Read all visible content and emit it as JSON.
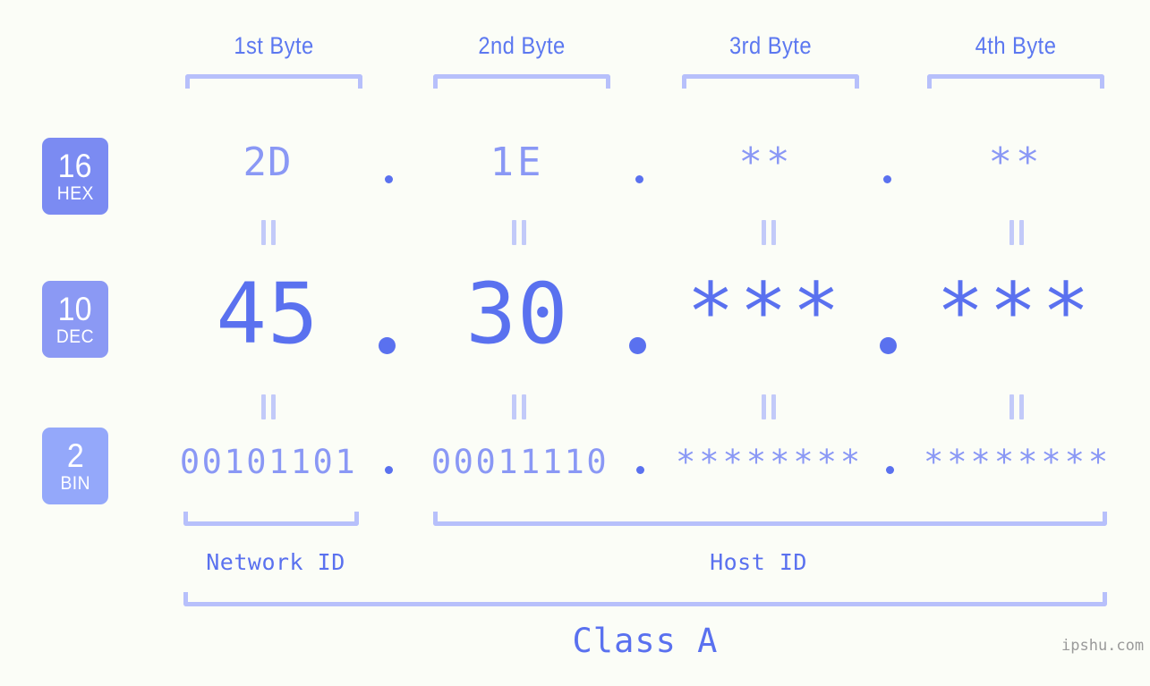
{
  "meta": {
    "background_color": "#fbfdf7",
    "accent_strong": "#5a71ef",
    "accent_light": "#8a98f5",
    "bracket_color": "#b7c0fb"
  },
  "headers": [
    {
      "label": "1st Byte"
    },
    {
      "label": "2nd Byte"
    },
    {
      "label": "3rd Byte"
    },
    {
      "label": "4th Byte"
    }
  ],
  "rows": [
    {
      "badge_number": "16",
      "badge_label": "HEX",
      "badge_color": "#7b8bf2",
      "values": [
        "2D",
        "1E",
        "**",
        "**"
      ],
      "separator": "."
    },
    {
      "badge_number": "10",
      "badge_label": "DEC",
      "badge_color": "#8b99f4",
      "values": [
        "45",
        "30",
        "***",
        "***"
      ],
      "separator": "."
    },
    {
      "badge_number": "2",
      "badge_label": "BIN",
      "badge_color": "#94a8fa",
      "values": [
        "00101101",
        "00011110",
        "********",
        "********"
      ],
      "separator": "."
    }
  ],
  "equals_symbol": "=",
  "footer": {
    "network_id_label": "Network ID",
    "host_id_label": "Host ID",
    "class_label": "Class A",
    "watermark": "ipshu.com"
  }
}
